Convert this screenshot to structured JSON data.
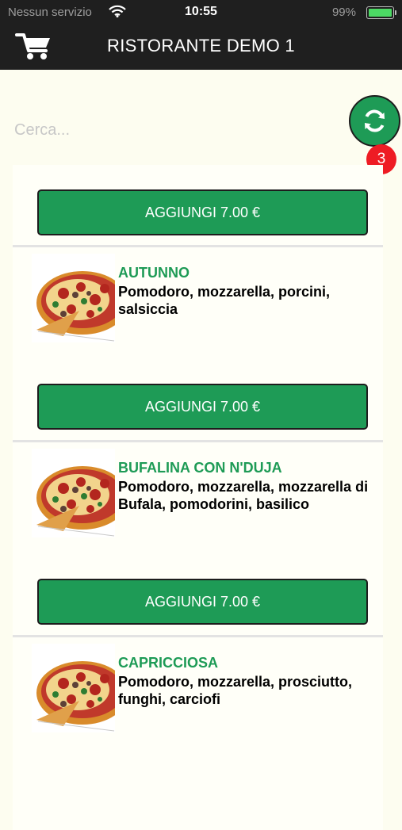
{
  "status_bar": {
    "carrier": "Nessun servizio",
    "time": "10:55",
    "battery": "99%",
    "battery_level": 0.99,
    "icons": [
      "wifi-icon",
      "battery-icon"
    ]
  },
  "header": {
    "title": "RISTORANTE DEMO 1",
    "cart_icon": "cart-icon"
  },
  "search": {
    "placeholder": "Cerca..."
  },
  "refresh": {
    "icon": "refresh-icon",
    "badge_count": "3"
  },
  "colors": {
    "accent": "#1e9b56",
    "badge": "#ee1c24",
    "bar": "#1f1f1f",
    "background": "#fdfdf0"
  },
  "first_item": {
    "button_label": "AGGIUNGI 7.00 €"
  },
  "items": [
    {
      "name": "AUTUNNO",
      "description": "Pomodoro, mozzarella, porcini, salsiccia",
      "button_label": "AGGIUNGI 7.00 €"
    },
    {
      "name": "BUFALINA CON N'DUJA",
      "description": "Pomodoro, mozzarella, mozzarella di Bufala, pomodorini, basilico",
      "button_label": "AGGIUNGI 7.00 €"
    },
    {
      "name": "CAPRICCIOSA",
      "description": "Pomodoro, mozzarella, prosciutto, funghi, carciofi",
      "button_label": ""
    }
  ]
}
